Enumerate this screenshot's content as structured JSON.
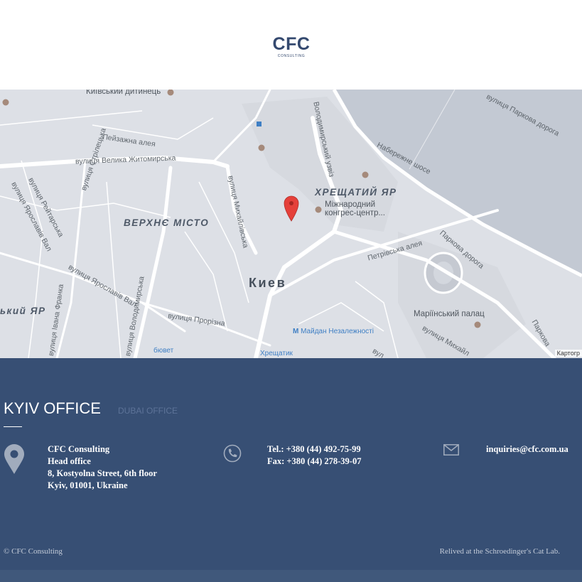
{
  "header": {
    "logo_mark": "CFC",
    "logo_sub": "CONSULTING"
  },
  "map": {
    "labels": {
      "kyiv_citadel": "Київський дитинець",
      "peizazhna": "Пейзажна алея",
      "velyka_zhytomyrska": "вулиця Велика Житомирська",
      "strilecka": "вулиця Стрілецька",
      "reitarska": "вулиця Рейтарська",
      "yaroslaviv_val_1": "вулиця Ярославів Вал",
      "yaroslaviv_val_2": "вулиця Ярославів Вал",
      "verkhnie_misto": "ВЕРХНЄ МІСТО",
      "mykhailivska": "вулиця Михайлівська",
      "volodymyrskyi_uzviz": "Володимирський узвіз",
      "naberezhne": "Набережне шосе",
      "khreshchatyi_yar": "ХРЕЩАТИЙ ЯР",
      "congress_1": "Міжнародний",
      "congress_2": "конгрес-центр...",
      "parkova_top": "вулиця Паркова дорога",
      "petrivska": "Петрівська алея",
      "parkova_mid": "Паркова дорога",
      "city": "Киев",
      "kyi_yar": "ький ЯР",
      "ivana_franka": "вулиця Івана Франка",
      "volodymyrska": "вулиця Володимирська",
      "prorizna": "вулиця Прорізна",
      "mariinskyi": "Маріїнський палац",
      "mykhailo_right": "вулиця Михайл",
      "parkova_right": "Паркова",
      "maidan": "Майдан Незалежності",
      "khreshchatyk": "Хрещатик",
      "buvet": "бювет",
      "vul_bottom": "вул",
      "attribution": "Картогр"
    }
  },
  "footer": {
    "tabs": {
      "active": "KYIV OFFICE",
      "inactive": "DUBAI OFFICE"
    },
    "address": {
      "company": "CFC Consulting",
      "office": "Head office",
      "street": "8, Kostyolna Street, 6th floor",
      "city": "Kyiv, 01001, Ukraine"
    },
    "phones": {
      "tel": "Tel.: +380 (44) 492-75-99",
      "fax": "Fax: +380 (44) 278-39-07"
    },
    "email": "inquiries@cfc.com.ua",
    "copyright": "© CFC Consulting",
    "credit": "Relived at the Schroedinger's Cat Lab."
  },
  "colors": {
    "footer_bg": "#374f74",
    "brand": "#34496f",
    "map_bg": "#dde0e6",
    "marker": "#e5403a"
  },
  "icons": [
    "location-pin-icon",
    "phone-icon",
    "envelope-icon",
    "map-marker-icon",
    "metro-icon"
  ]
}
